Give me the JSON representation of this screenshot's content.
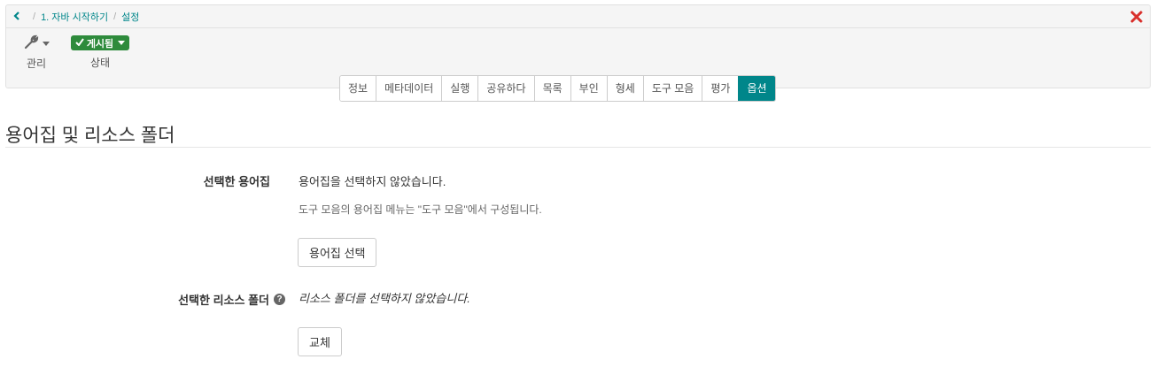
{
  "breadcrumb": {
    "items": [
      "1. 자바 시작하기",
      "설정"
    ]
  },
  "toolbar": {
    "manage_label": "관리",
    "status_badge": "게시됨",
    "status_label": "상태"
  },
  "tabs": [
    {
      "label": "정보",
      "active": false
    },
    {
      "label": "메타데이터",
      "active": false
    },
    {
      "label": "실행",
      "active": false
    },
    {
      "label": "공유하다",
      "active": false
    },
    {
      "label": "목록",
      "active": false
    },
    {
      "label": "부인",
      "active": false
    },
    {
      "label": "형세",
      "active": false
    },
    {
      "label": "도구 모음",
      "active": false
    },
    {
      "label": "평가",
      "active": false
    },
    {
      "label": "옵션",
      "active": true
    }
  ],
  "section": {
    "title": "용어집 및 리소스 폴더"
  },
  "glossary": {
    "label": "선택한 용어집",
    "value": "용어집을 선택하지 않았습니다.",
    "hint": "도구 모음의 용어집 메뉴는 \"도구 모음\"에서 구성됩니다.",
    "button": "용어집 선택"
  },
  "resource_folder": {
    "label": "선택한 리소스 폴더",
    "value": "리소스 폴더를 선택하지 않았습니다.",
    "button": "교체"
  },
  "colors": {
    "accent": "#00868a",
    "status_green": "#2e8b3c",
    "close_red": "#d9302c"
  },
  "icons": [
    "chevron-left-icon",
    "close-icon",
    "wrench-icon",
    "check-icon",
    "caret-down-icon",
    "help-icon"
  ]
}
